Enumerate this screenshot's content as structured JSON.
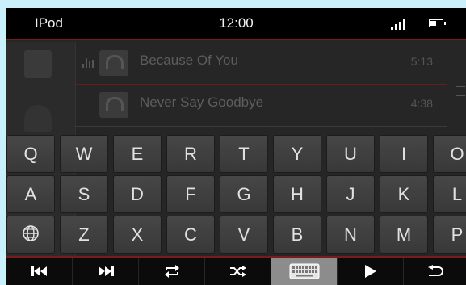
{
  "status_bar": {
    "app_name": "IPod",
    "time": "12:00",
    "battery_level": 0.5,
    "signal_bars": 4
  },
  "playlist": {
    "tracks": [
      {
        "title": "Because Of You",
        "duration": "5:13",
        "playing": true
      },
      {
        "title": "Never Say Goodbye",
        "duration": "4:38",
        "playing": false
      }
    ]
  },
  "keyboard": {
    "row1": [
      "Q",
      "W",
      "E",
      "R",
      "T",
      "Y",
      "U",
      "I",
      "O"
    ],
    "row2": [
      "A",
      "S",
      "D",
      "F",
      "G",
      "H",
      "J",
      "K",
      "L"
    ],
    "row3": [
      "Z",
      "X",
      "C",
      "V",
      "B",
      "N",
      "M",
      "P"
    ],
    "language_key_icon": "globe-icon"
  },
  "controls": {
    "icons": [
      "previous-track-icon",
      "next-track-icon",
      "repeat-icon",
      "shuffle-icon",
      "keyboard-icon",
      "play-icon",
      "back-icon"
    ],
    "active": "keyboard-icon"
  },
  "colors": {
    "accent": "#7a1b1b",
    "frame": "#c9f0fb",
    "key": "#444444"
  }
}
